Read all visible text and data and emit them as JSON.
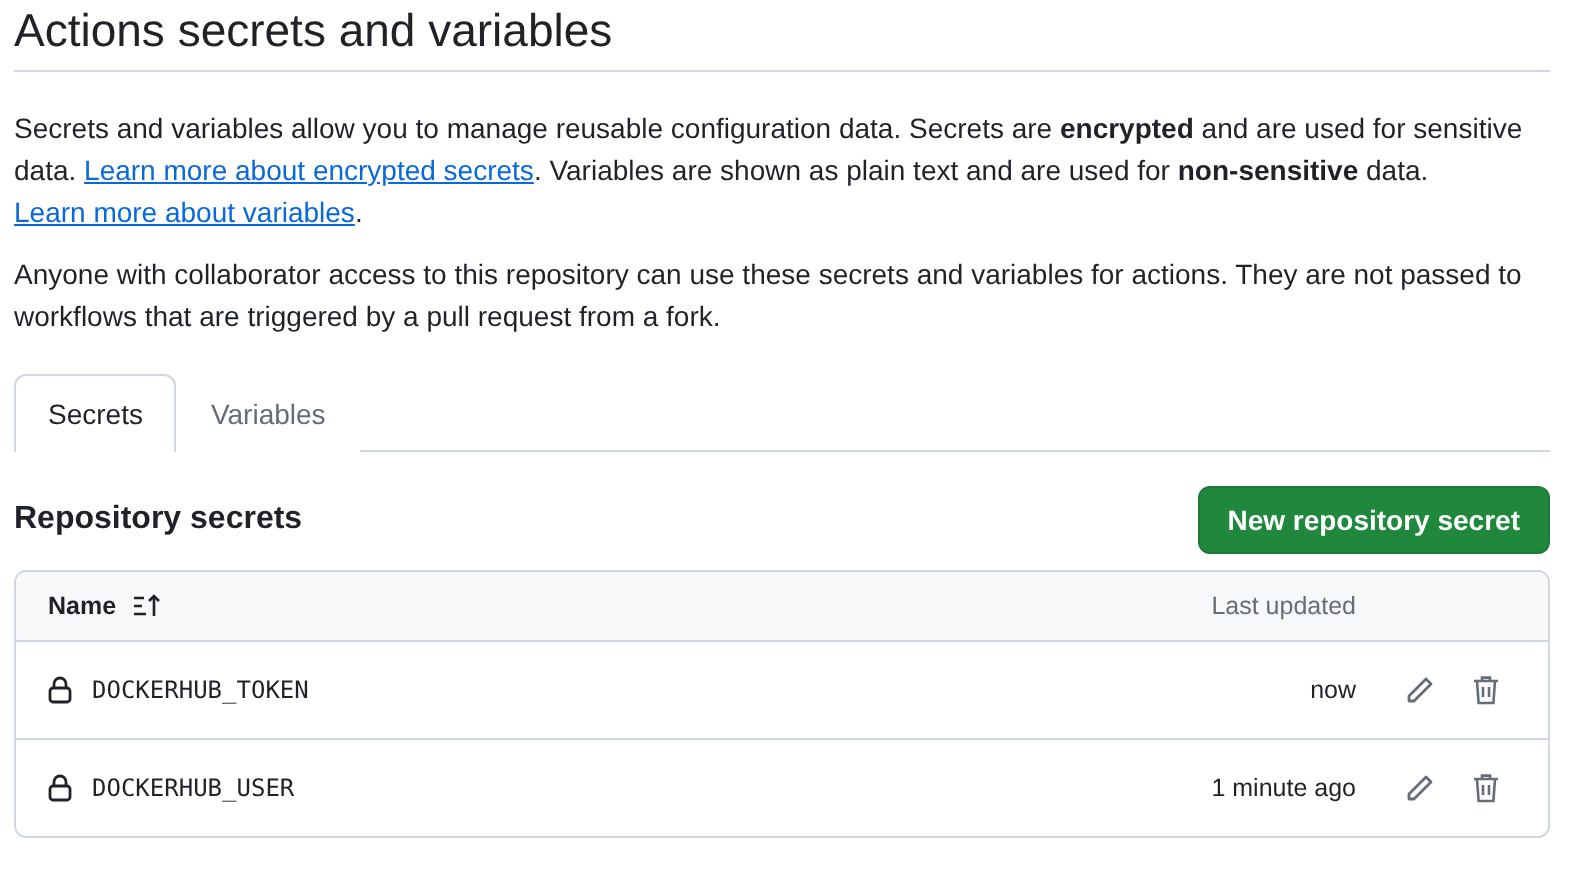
{
  "page": {
    "title": "Actions secrets and variables"
  },
  "intro": [
    {
      "kind": "text",
      "text": "Secrets and variables allow you to manage reusable configuration data. Secrets are **encrypted** and are used for sensitive data. "
    },
    {
      "kind": "link",
      "text": "Learn more about encrypted secrets"
    },
    {
      "kind": "text",
      "text": ". Variables are shown as plain text and are used for **non-sensitive** data. "
    },
    {
      "kind": "link",
      "text": "Learn more about variables"
    },
    {
      "kind": "text",
      "text": "."
    }
  ],
  "note": "Anyone with collaborator access to this repository can use these secrets and variables for actions. They are not passed to workflows that are triggered by a pull request from a fork.",
  "tabs": [
    {
      "label": "Secrets",
      "selected": true
    },
    {
      "label": "Variables",
      "selected": false
    }
  ],
  "section": {
    "title": "Repository secrets",
    "button": "New repository secret"
  },
  "table": {
    "columns": [
      "Name",
      "Last updated"
    ],
    "rows": [
      {
        "name": "DOCKERHUB_TOKEN",
        "updated": "now"
      },
      {
        "name": "DOCKERHUB_USER",
        "updated": "1 minute ago"
      }
    ]
  }
}
